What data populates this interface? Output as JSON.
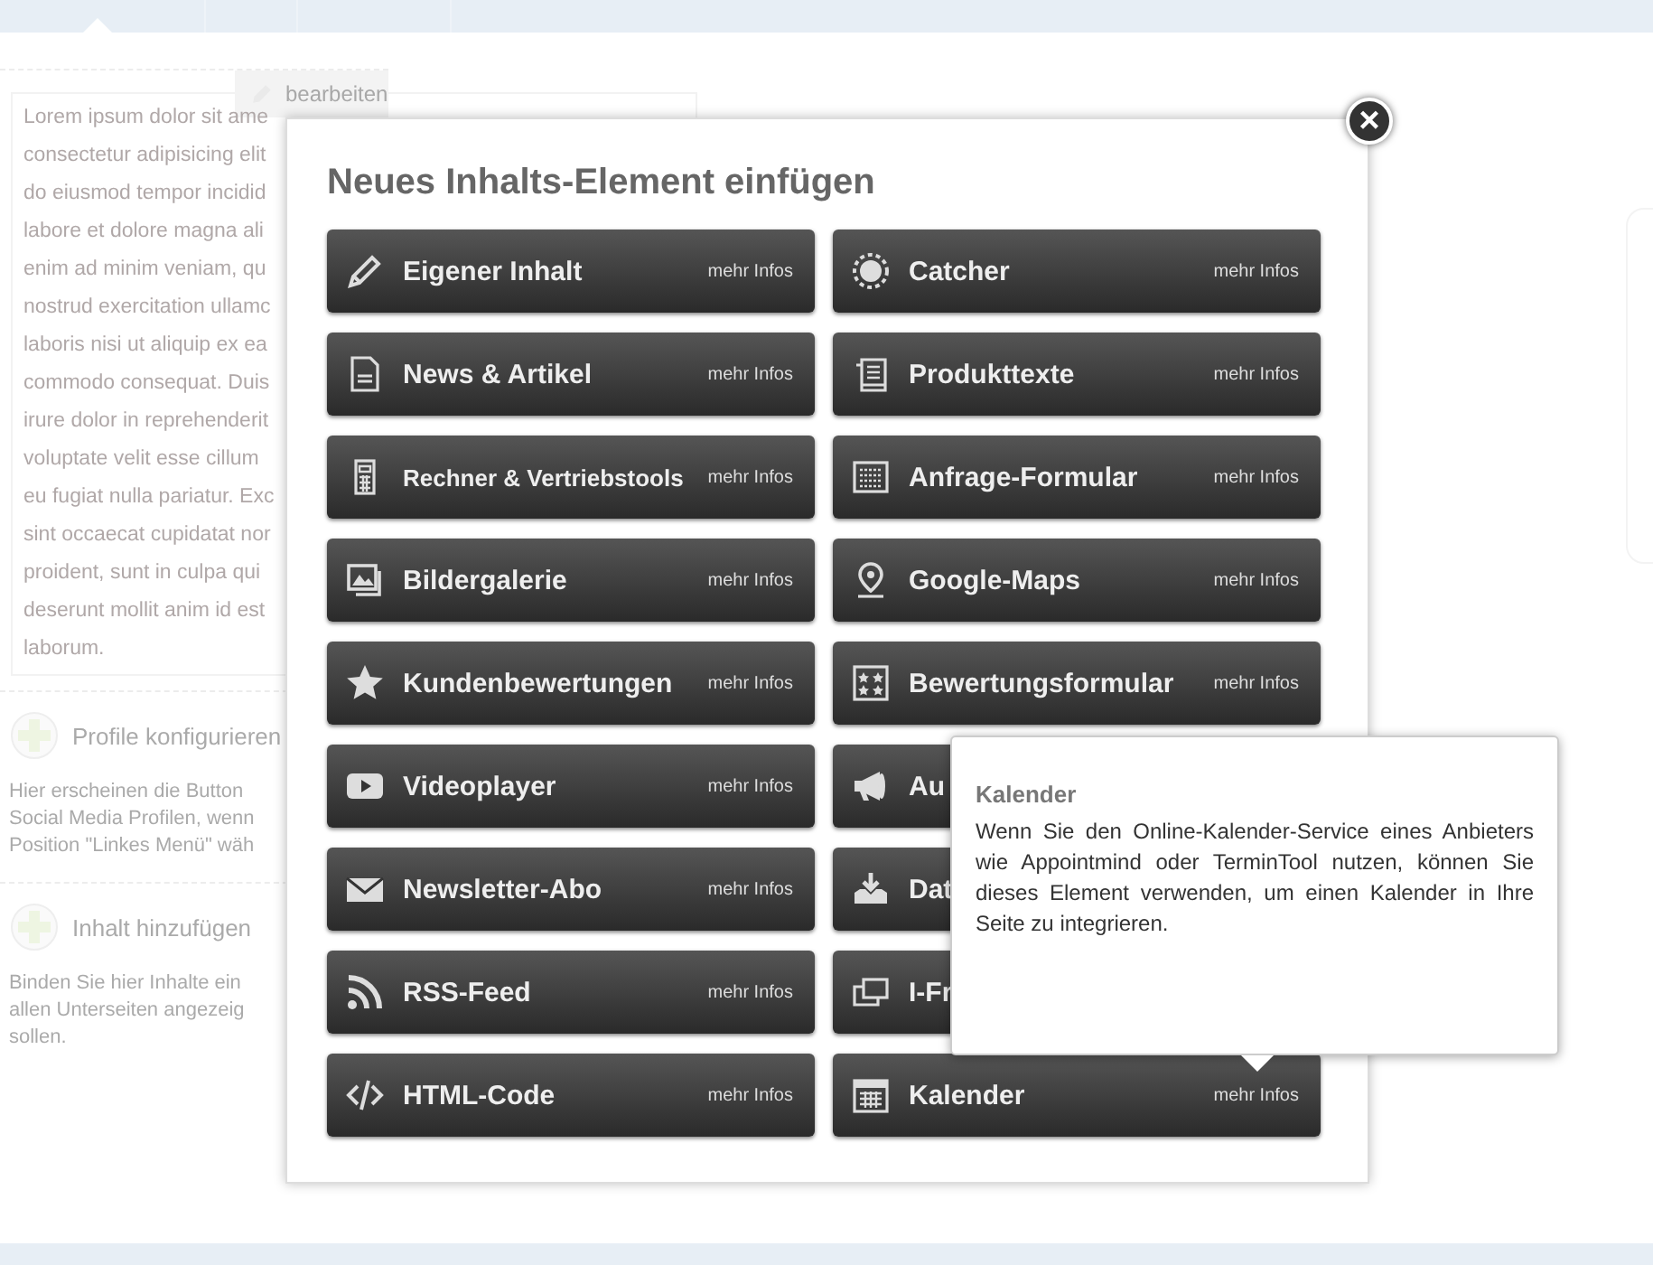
{
  "background": {
    "edit_button": "bearbeiten",
    "lorem_lines": [
      "Lorem ipsum dolor sit ame",
      "consectetur adipisicing elit",
      "do eiusmod tempor incidid",
      "labore et dolore magna ali",
      "enim ad minim veniam, qu",
      "nostrud exercitation ullamc",
      "laboris nisi ut aliquip ex ea",
      "commodo consequat. Duis",
      "irure dolor in reprehenderit",
      "voluptate velit esse cillum",
      "eu fugiat nulla pariatur. Exc",
      "sint occaecat cupidatat nor",
      "proident, sunt in culpa qui",
      "deserunt mollit anim id est",
      "laborum."
    ],
    "sections": [
      {
        "title": "Profile konfigurieren",
        "lines": [
          "Hier erscheinen die Button",
          "Social Media Profilen, wenn",
          "Position \"Linkes Menü\" wäh"
        ]
      },
      {
        "title": "Inhalt hinzufügen",
        "lines": [
          "Binden Sie hier Inhalte ein",
          "allen Unterseiten angezeig",
          "sollen."
        ]
      }
    ]
  },
  "modal": {
    "title": "Neues Inhalts-Element einfügen",
    "close": "×",
    "items": [
      {
        "label": "Eigener Inhalt",
        "more": "mehr Infos"
      },
      {
        "label": "Catcher",
        "more": "mehr Infos"
      },
      {
        "label": "News & Artikel",
        "more": "mehr Infos"
      },
      {
        "label": "Produkttexte",
        "more": "mehr Infos"
      },
      {
        "label": "Rechner & Vertriebstools",
        "more": "mehr Infos"
      },
      {
        "label": "Anfrage-Formular",
        "more": "mehr Infos"
      },
      {
        "label": "Bildergalerie",
        "more": "mehr Infos"
      },
      {
        "label": "Google-Maps",
        "more": "mehr Infos"
      },
      {
        "label": "Kundenbewertungen",
        "more": "mehr Infos"
      },
      {
        "label": "Bewertungsformular",
        "more": "mehr Infos"
      },
      {
        "label": "Videoplayer",
        "more": "mehr Infos"
      },
      {
        "label": "Au"
      },
      {
        "label": "Newsletter-Abo",
        "more": "mehr Infos"
      },
      {
        "label": "Dat"
      },
      {
        "label": "RSS-Feed",
        "more": "mehr Infos"
      },
      {
        "label": "I-Fr"
      },
      {
        "label": "HTML-Code",
        "more": "mehr Infos"
      },
      {
        "label": "Kalender",
        "more": "mehr Infos"
      }
    ],
    "tooltip": {
      "title": "Kalender",
      "text": "Wenn Sie den Online-Kalender-Service eines Anbieters wie Appointmind oder TerminTool nutzen, können Sie dieses Element verwenden, um einen Kalender in Ihre Seite zu integrieren."
    }
  }
}
